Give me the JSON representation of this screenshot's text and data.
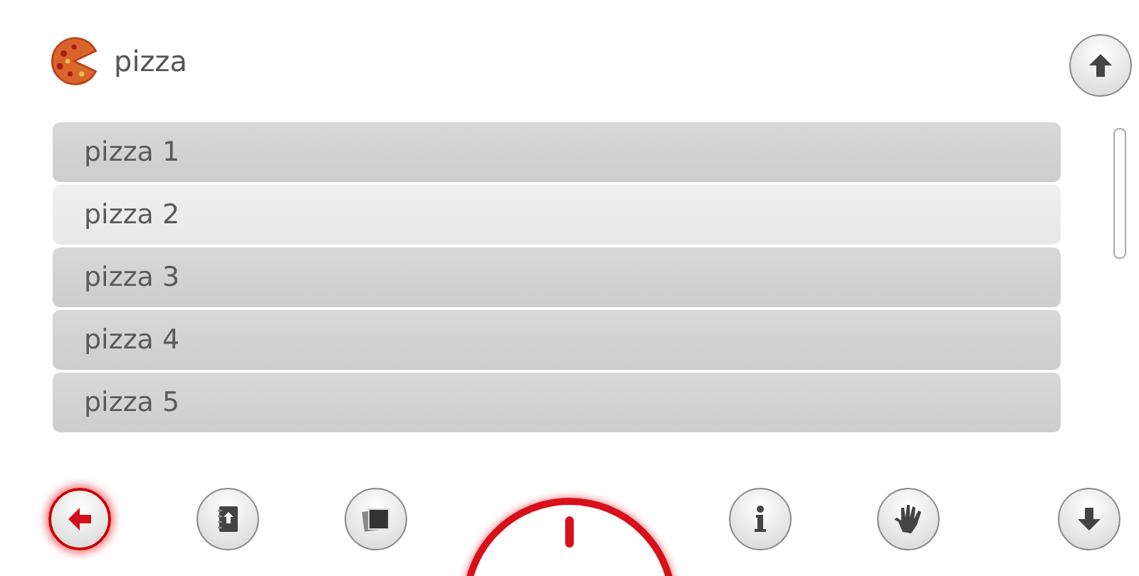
{
  "header": {
    "title": "pizza"
  },
  "list": [
    {
      "label": "pizza 1",
      "selected": false
    },
    {
      "label": "pizza 2",
      "selected": true
    },
    {
      "label": "pizza 3",
      "selected": false
    },
    {
      "label": "pizza 4",
      "selected": false
    },
    {
      "label": "pizza 5",
      "selected": false
    }
  ],
  "toolbar": [
    {
      "kind": "back",
      "highlighted": true
    },
    {
      "kind": "notebook",
      "highlighted": false
    },
    {
      "kind": "photos",
      "highlighted": false
    },
    {
      "kind": "dial",
      "highlighted": true
    },
    {
      "kind": "info",
      "highlighted": false
    },
    {
      "kind": "glove",
      "highlighted": false
    },
    {
      "kind": "down",
      "highlighted": false
    }
  ]
}
